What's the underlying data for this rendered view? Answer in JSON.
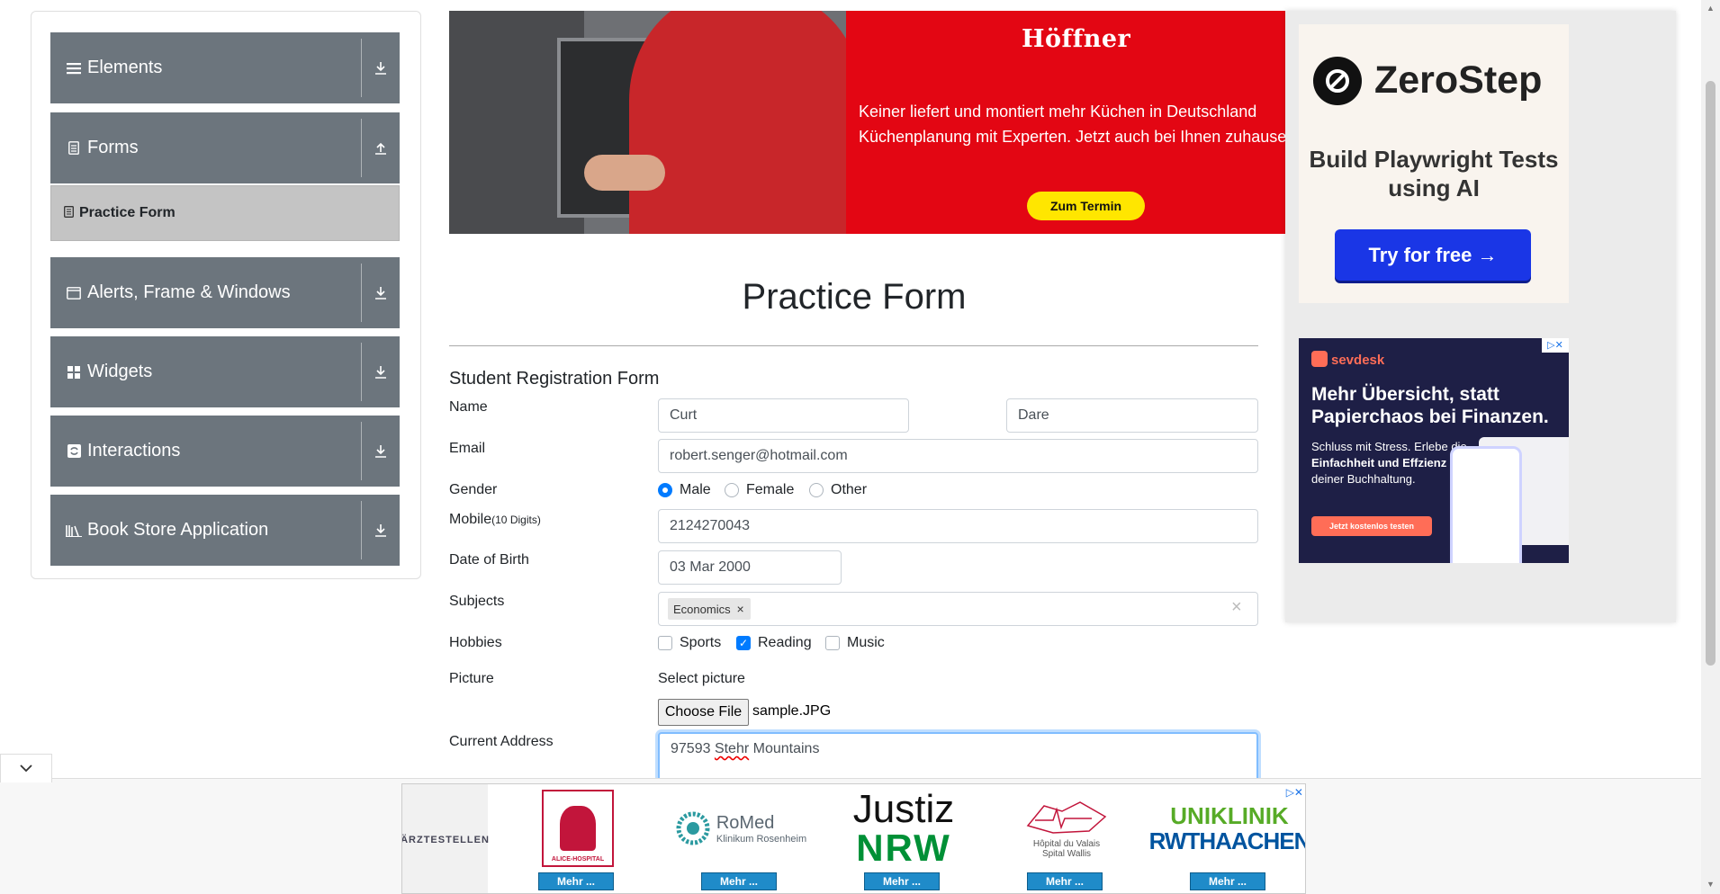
{
  "sidebar": {
    "groups": [
      {
        "label": "Elements",
        "icon": "hamburger-icon",
        "toggle": "download-icon"
      },
      {
        "label": "Forms",
        "icon": "document-icon",
        "toggle": "upload-icon"
      },
      {
        "label": "Alerts, Frame & Windows",
        "icon": "window-icon",
        "toggle": "download-icon"
      },
      {
        "label": "Widgets",
        "icon": "grid-icon",
        "toggle": "download-icon"
      },
      {
        "label": "Interactions",
        "icon": "interactions-icon",
        "toggle": "download-icon"
      },
      {
        "label": "Book Store Application",
        "icon": "books-icon",
        "toggle": "download-icon"
      }
    ],
    "active_item": {
      "label": "Practice Form",
      "icon": "document-icon"
    }
  },
  "banner_ad": {
    "brand": "Höffner",
    "text_line1": "Keiner liefert und montiert mehr Küchen in Deutschland",
    "text_line2": "Küchenplanung mit Experten. Jetzt auch bei Ihnen zuhause",
    "cta": "Zum Termin",
    "accent": "#e30613"
  },
  "zerostep_ad": {
    "name": "ZeroStep",
    "tagline": "Build Playwright Tests using AI",
    "cta": "Try for free →",
    "accent": "#1a36e6"
  },
  "sevdesk_ad": {
    "logo": "sevdesk",
    "headline": "Mehr Übersicht, statt Papierchaos bei Finanzen.",
    "body_pre": "Schluss mit Stress. Erlebe die ",
    "body_bold1": "Einfachheit und Effzienz",
    "body_post": " bei deiner Buchhaltung.",
    "cta": "Jetzt kostenlos testen"
  },
  "form": {
    "title": "Practice Form",
    "subtitle": "Student Registration Form",
    "labels": {
      "name": "Name",
      "email": "Email",
      "gender": "Gender",
      "mobile": "Mobile",
      "mobile_hint": "(10 Digits)",
      "dob": "Date of Birth",
      "subjects": "Subjects",
      "hobbies": "Hobbies",
      "picture": "Picture",
      "address": "Current Address"
    },
    "first_name": "Curt",
    "last_name": "Dare",
    "email": "robert.senger@hotmail.com",
    "gender_options": [
      {
        "label": "Male",
        "selected": true
      },
      {
        "label": "Female",
        "selected": false
      },
      {
        "label": "Other",
        "selected": false
      }
    ],
    "mobile": "2124270043",
    "dob": "03 Mar 2000",
    "subjects": [
      "Economics"
    ],
    "subject_remove": "×",
    "subjects_clear": "×",
    "hobbies": [
      {
        "label": "Sports",
        "checked": false
      },
      {
        "label": "Reading",
        "checked": true
      },
      {
        "label": "Music",
        "checked": false
      }
    ],
    "picture_label": "Select picture",
    "choose_file": "Choose File",
    "file_name": "sample.JPG",
    "address_pre": "97593 ",
    "address_misspelled": "Stehr",
    "address_post": " Mountains"
  },
  "bottom_ad": {
    "sponsor": "ÄRZTESTELLEN",
    "slots": [
      {
        "name": "ALICE-HOSPITAL",
        "cta": "Mehr ..."
      },
      {
        "name": "RoMed",
        "sub": "Klinikum Rosenheim",
        "cta": "Mehr ..."
      },
      {
        "name": "Justiz",
        "sub": "NRW",
        "cta": "Mehr ..."
      },
      {
        "name": "Hôpital du Valais",
        "sub": "Spital Wallis",
        "cta": "Mehr ..."
      },
      {
        "name": "UNIKLINIK",
        "sub": "RWTHAACHEN",
        "cta": "Mehr ..."
      }
    ]
  }
}
